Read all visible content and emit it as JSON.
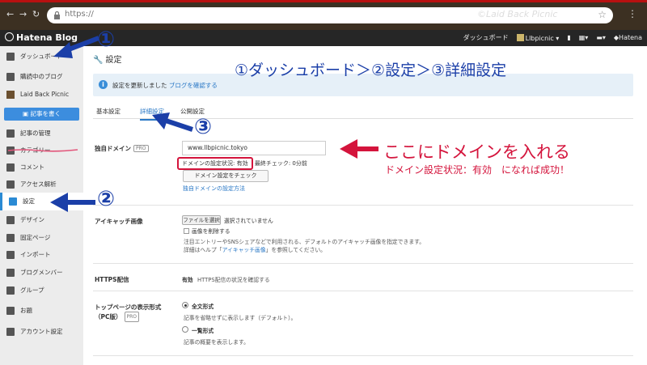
{
  "browser": {
    "url": "https://",
    "watermark": "©Laid Back Picnic"
  },
  "topbar": {
    "brand": "Hatena Blog",
    "dashboard": "ダッシュボード",
    "user": "Llbpicnic",
    "hatena": "Hatena"
  },
  "sidebar": {
    "items": [
      {
        "label": "ダッシュボード",
        "icon": "home-icon"
      },
      {
        "label": "購読中のブログ",
        "icon": "bookmark-icon"
      },
      {
        "label": "記事の管理",
        "icon": "document-icon"
      },
      {
        "label": "カテゴリー",
        "icon": "folder-icon"
      },
      {
        "label": "コメント",
        "icon": "comment-icon"
      },
      {
        "label": "アクセス解析",
        "icon": "chart-icon"
      },
      {
        "label": "設定",
        "icon": "wrench-icon"
      },
      {
        "label": "デザイン",
        "icon": "palette-icon"
      },
      {
        "label": "固定ページ",
        "icon": "page-icon"
      },
      {
        "label": "インポート",
        "icon": "import-icon"
      },
      {
        "label": "ブログメンバー",
        "icon": "members-icon"
      },
      {
        "label": "グループ",
        "icon": "group-icon"
      },
      {
        "label": "お題",
        "icon": "theme-icon"
      },
      {
        "label": "アカウント設定",
        "icon": "account-icon"
      }
    ],
    "blog_name": "Laid Back Picnic",
    "write_button": "記事を書く"
  },
  "main": {
    "page_title": "設定",
    "notice_text": "設定を更新しました",
    "notice_link": "ブログを確認する",
    "tabs": [
      "基本設定",
      "詳細設定",
      "公開設定"
    ],
    "domain": {
      "label": "独自ドメイン",
      "pro": "PRO",
      "value": "www.llbpicnic.tokyo",
      "status": "ドメインの設定状況: 有効",
      "last_check": "最終チェック: 0分前",
      "check_button": "ドメイン設定をチェック",
      "howto_link": "独自ドメインの設定方法"
    },
    "eyecatch": {
      "label": "アイキャッチ画像",
      "file_button": "ファイルを選択",
      "no_file": "選択されていません",
      "delete_checkbox": "画像を削除する",
      "desc": "注目エントリーやSNSシェアなどで利用される、デフォルトのアイキャッチ画像を指定できます。",
      "help_prefix": "詳細はヘルプ「",
      "help_link": "アイキャッチ画像",
      "help_suffix": "」を参照してください。"
    },
    "https": {
      "label": "HTTPS配信",
      "status": "有効",
      "link": "HTTPS配信の状況を確認する"
    },
    "display": {
      "label": "トップページの表示形式（PC版）",
      "pro": "PRO",
      "opt1": "全文形式",
      "opt1_desc": "記事を省略せずに表示します（デフォルト）。",
      "opt2": "一覧形式",
      "opt2_desc": "記事の概要を表示します。"
    }
  },
  "annotations": {
    "steps_title": "①ダッシュボード＞②設定＞③詳細設定",
    "num1": "①",
    "num2": "②",
    "num3": "③",
    "enter_domain": "ここにドメインを入れる",
    "success_note": "ドメイン設定状況：有効　になれば成功！",
    "blue": "#1b3fa8",
    "red": "#d4143c"
  }
}
